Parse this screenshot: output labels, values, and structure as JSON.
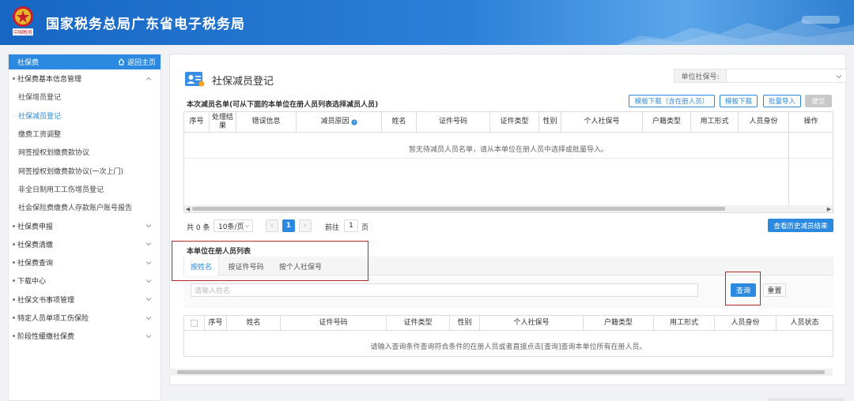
{
  "header": {
    "title": "国家税务总局广东省电子税务局",
    "emblem_text": "中国税务"
  },
  "sidebar": {
    "title": "社保费",
    "back_label": "返回主页",
    "groups": [
      {
        "label": "社保费基本信息管理",
        "expanded": true,
        "items": [
          {
            "label": "社保增员登记",
            "active": false
          },
          {
            "label": "社保减员登记",
            "active": true
          },
          {
            "label": "缴费工资调整",
            "active": false
          },
          {
            "label": "网签授权划缴费款协议",
            "active": false
          },
          {
            "label": "网签授权划缴费款协议(一次上门)",
            "active": false
          },
          {
            "label": "非全日制用工工伤增员登记",
            "active": false
          },
          {
            "label": "社会保险费缴费人存款账户账号报告",
            "active": false
          }
        ]
      },
      {
        "label": "社保费申报",
        "expanded": false
      },
      {
        "label": "社保费清缴",
        "expanded": false
      },
      {
        "label": "社保费查询",
        "expanded": false
      },
      {
        "label": "下载中心",
        "expanded": false
      },
      {
        "label": "社保文书事项管理",
        "expanded": false
      },
      {
        "label": "特定人员单项工伤保险",
        "expanded": false
      },
      {
        "label": "阶段性缓缴社保费",
        "expanded": false
      }
    ]
  },
  "page": {
    "title": "社保减员登记",
    "unit_label": "单位社保号:",
    "unit_value": ""
  },
  "section1": {
    "title": "本次减员名单(可从下面的本单位在册人员列表选择减员人员)",
    "buttons": {
      "template_with_members": "模板下载（含在册人员）",
      "template": "模板下载",
      "batch_import": "批量导入",
      "submit": "提交"
    },
    "columns": [
      "序号",
      "处理结果",
      "错误信息",
      "减员原因",
      "姓名",
      "证件号码",
      "证件类型",
      "性别",
      "个人社保号",
      "户籍类型",
      "用工形式",
      "人员身份",
      "操作"
    ],
    "empty_text": "暂无待减员人员名单，请从本单位在册人员中选择或批量导入。"
  },
  "pager": {
    "total": "共 0 条",
    "page_size": "10条/页",
    "current_page": "1",
    "goto_label": "前往",
    "goto_value": "1",
    "page_suffix": "页"
  },
  "history_button": "查看历史减员结果",
  "section2": {
    "title": "本单位在册人员列表",
    "tabs": [
      "按姓名",
      "按证件号码",
      "按个人社保号"
    ],
    "active_tab": 0,
    "search_placeholder": "请输入姓名",
    "query_label": "查询",
    "reset_label": "重置",
    "columns": [
      "序号",
      "姓名",
      "证件号码",
      "证件类型",
      "性别",
      "个人社保号",
      "户籍类型",
      "用工形式",
      "人员身份",
      "人员状态"
    ],
    "empty_text": "请输入查询条件查询符合条件的在册人员或者直接点击[查询]查询本单位所有在册人员。"
  },
  "colors": {
    "primary": "#2b8ae0",
    "header_blue": "#1766c4",
    "highlight_red": "#b5272b"
  }
}
